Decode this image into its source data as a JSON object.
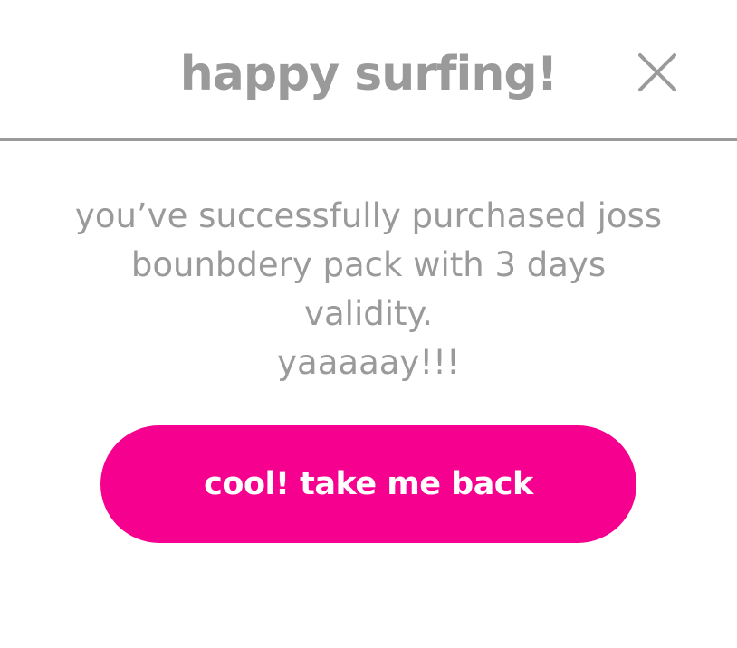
{
  "dialog": {
    "title": "happy surfing!",
    "close_icon": "close-icon",
    "message_lines": [
      "you’ve successfully purchased joss",
      "bounbdery pack with 3 days validity.",
      "yaaaaay!!!"
    ],
    "primary_button_label": "cool! take me back"
  },
  "colors": {
    "text_gray": "#9a9a9a",
    "accent_pink": "#f5008f",
    "background": "#ffffff"
  }
}
